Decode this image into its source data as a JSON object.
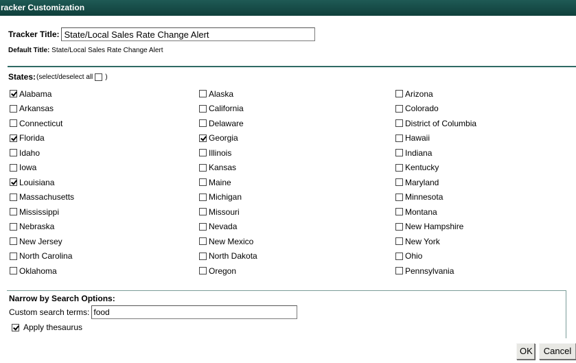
{
  "window": {
    "title": "racker Customization"
  },
  "tracker": {
    "title_label": "Tracker Title:",
    "title_value": "State/Local Sales Rate Change Alert",
    "default_label": "Default Title:",
    "default_value": "State/Local Sales Rate Change Alert"
  },
  "states": {
    "label": "States:",
    "select_all_label": "(select/deselect all",
    "select_all_close": ")",
    "select_all_checked": false,
    "rows": [
      [
        {
          "name": "Alabama",
          "checked": true
        },
        {
          "name": "Alaska",
          "checked": false
        },
        {
          "name": "Arizona",
          "checked": false
        }
      ],
      [
        {
          "name": "Arkansas",
          "checked": false
        },
        {
          "name": "California",
          "checked": false
        },
        {
          "name": "Colorado",
          "checked": false
        }
      ],
      [
        {
          "name": "Connecticut",
          "checked": false
        },
        {
          "name": "Delaware",
          "checked": false
        },
        {
          "name": "District of Columbia",
          "checked": false
        }
      ],
      [
        {
          "name": "Florida",
          "checked": true
        },
        {
          "name": "Georgia",
          "checked": true
        },
        {
          "name": "Hawaii",
          "checked": false
        }
      ],
      [
        {
          "name": "Idaho",
          "checked": false
        },
        {
          "name": "Illinois",
          "checked": false
        },
        {
          "name": "Indiana",
          "checked": false
        }
      ],
      [
        {
          "name": "Iowa",
          "checked": false
        },
        {
          "name": "Kansas",
          "checked": false
        },
        {
          "name": "Kentucky",
          "checked": false
        }
      ],
      [
        {
          "name": "Louisiana",
          "checked": true
        },
        {
          "name": "Maine",
          "checked": false
        },
        {
          "name": "Maryland",
          "checked": false
        }
      ],
      [
        {
          "name": "Massachusetts",
          "checked": false
        },
        {
          "name": "Michigan",
          "checked": false
        },
        {
          "name": "Minnesota",
          "checked": false
        }
      ],
      [
        {
          "name": "Mississippi",
          "checked": false
        },
        {
          "name": "Missouri",
          "checked": false
        },
        {
          "name": "Montana",
          "checked": false
        }
      ],
      [
        {
          "name": "Nebraska",
          "checked": false
        },
        {
          "name": "Nevada",
          "checked": false
        },
        {
          "name": "New Hampshire",
          "checked": false
        }
      ],
      [
        {
          "name": "New Jersey",
          "checked": false
        },
        {
          "name": "New Mexico",
          "checked": false
        },
        {
          "name": "New York",
          "checked": false
        }
      ],
      [
        {
          "name": "North Carolina",
          "checked": false
        },
        {
          "name": "North Dakota",
          "checked": false
        },
        {
          "name": "Ohio",
          "checked": false
        }
      ],
      [
        {
          "name": "Oklahoma",
          "checked": false
        },
        {
          "name": "Oregon",
          "checked": false
        },
        {
          "name": "Pennsylvania",
          "checked": false
        }
      ]
    ]
  },
  "narrow": {
    "heading": "Narrow by Search Options:",
    "search_label": "Custom search terms:",
    "search_value": "food",
    "thesaurus_label": "Apply thesaurus",
    "thesaurus_checked": true
  },
  "buttons": {
    "ok": "OK",
    "cancel": "Cancel"
  },
  "colors": {
    "titlebar": "#0f3f3b",
    "rule": "#2f6a64"
  }
}
